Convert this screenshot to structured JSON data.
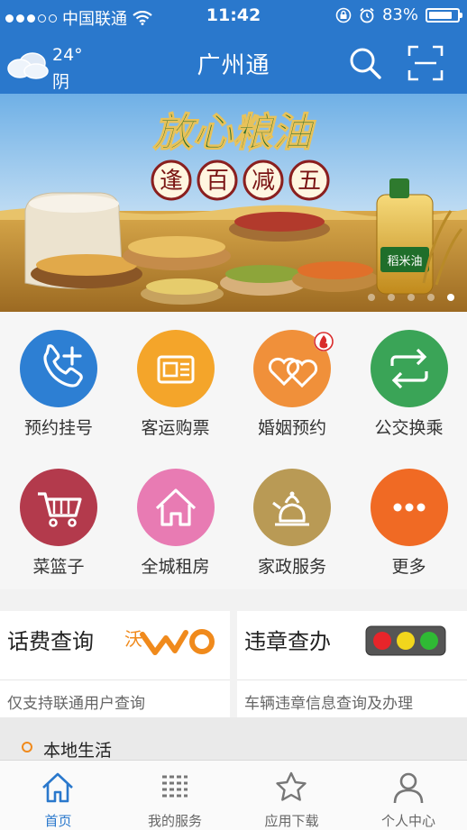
{
  "status_bar": {
    "carrier": "中国联通",
    "time": "11:42",
    "battery": "83%",
    "battery_level": 0.83
  },
  "header": {
    "title": "广州通",
    "weather_temp": "24°",
    "weather_cond": "阴"
  },
  "banner": {
    "headline": "放心粮油",
    "chars": [
      "逢",
      "百",
      "减",
      "五"
    ],
    "product_label": "稻米油",
    "slides": 5,
    "active_slide": 5
  },
  "services": [
    {
      "label": "预约挂号",
      "icon": "phone-plus-icon",
      "color": "#2d7fd3"
    },
    {
      "label": "客运购票",
      "icon": "ticket-icon",
      "color": "#f4a52a"
    },
    {
      "label": "婚姻预约",
      "icon": "hearts-icon",
      "color": "#f0903a"
    },
    {
      "label": "公交换乘",
      "icon": "transfer-icon",
      "color": "#3aa457"
    },
    {
      "label": "菜篮子",
      "icon": "cart-icon",
      "color": "#b33a4c"
    },
    {
      "label": "全城租房",
      "icon": "house-icon",
      "color": "#e87bb3"
    },
    {
      "label": "家政服务",
      "icon": "kettle-icon",
      "color": "#b99a55"
    },
    {
      "label": "更多",
      "icon": "more-icon",
      "color": "#f06a24"
    }
  ],
  "cards": {
    "phone_fee": {
      "title": "话费查询",
      "subtitle": "仅支持联通用户查询",
      "logo_text": "沃"
    },
    "violation": {
      "title": "违章查办",
      "subtitle": "车辆违章信息查询及办理"
    }
  },
  "section": {
    "title": "本地生活"
  },
  "tabs": [
    {
      "label": "首页",
      "icon": "home-icon",
      "active": true
    },
    {
      "label": "我的服务",
      "icon": "list-icon",
      "active": false
    },
    {
      "label": "应用下载",
      "icon": "star-icon",
      "active": false
    },
    {
      "label": "个人中心",
      "icon": "person-icon",
      "active": false
    }
  ],
  "colors": {
    "brand": "#2a78cc",
    "accent": "#f08a1c"
  }
}
